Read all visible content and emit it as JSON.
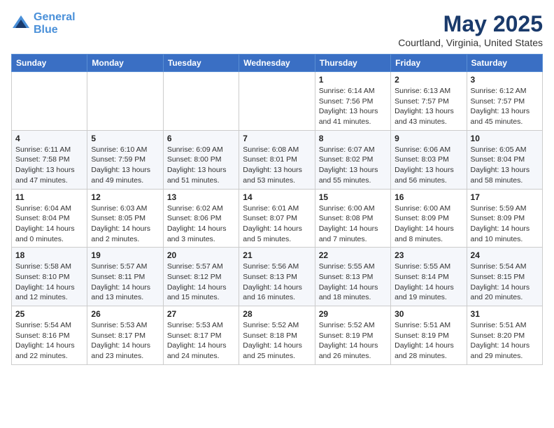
{
  "header": {
    "logo_line1": "General",
    "logo_line2": "Blue",
    "main_title": "May 2025",
    "subtitle": "Courtland, Virginia, United States"
  },
  "days_of_week": [
    "Sunday",
    "Monday",
    "Tuesday",
    "Wednesday",
    "Thursday",
    "Friday",
    "Saturday"
  ],
  "weeks": [
    [
      {
        "day": "",
        "info": ""
      },
      {
        "day": "",
        "info": ""
      },
      {
        "day": "",
        "info": ""
      },
      {
        "day": "",
        "info": ""
      },
      {
        "day": "1",
        "info": "Sunrise: 6:14 AM\nSunset: 7:56 PM\nDaylight: 13 hours\nand 41 minutes."
      },
      {
        "day": "2",
        "info": "Sunrise: 6:13 AM\nSunset: 7:57 PM\nDaylight: 13 hours\nand 43 minutes."
      },
      {
        "day": "3",
        "info": "Sunrise: 6:12 AM\nSunset: 7:57 PM\nDaylight: 13 hours\nand 45 minutes."
      }
    ],
    [
      {
        "day": "4",
        "info": "Sunrise: 6:11 AM\nSunset: 7:58 PM\nDaylight: 13 hours\nand 47 minutes."
      },
      {
        "day": "5",
        "info": "Sunrise: 6:10 AM\nSunset: 7:59 PM\nDaylight: 13 hours\nand 49 minutes."
      },
      {
        "day": "6",
        "info": "Sunrise: 6:09 AM\nSunset: 8:00 PM\nDaylight: 13 hours\nand 51 minutes."
      },
      {
        "day": "7",
        "info": "Sunrise: 6:08 AM\nSunset: 8:01 PM\nDaylight: 13 hours\nand 53 minutes."
      },
      {
        "day": "8",
        "info": "Sunrise: 6:07 AM\nSunset: 8:02 PM\nDaylight: 13 hours\nand 55 minutes."
      },
      {
        "day": "9",
        "info": "Sunrise: 6:06 AM\nSunset: 8:03 PM\nDaylight: 13 hours\nand 56 minutes."
      },
      {
        "day": "10",
        "info": "Sunrise: 6:05 AM\nSunset: 8:04 PM\nDaylight: 13 hours\nand 58 minutes."
      }
    ],
    [
      {
        "day": "11",
        "info": "Sunrise: 6:04 AM\nSunset: 8:04 PM\nDaylight: 14 hours\nand 0 minutes."
      },
      {
        "day": "12",
        "info": "Sunrise: 6:03 AM\nSunset: 8:05 PM\nDaylight: 14 hours\nand 2 minutes."
      },
      {
        "day": "13",
        "info": "Sunrise: 6:02 AM\nSunset: 8:06 PM\nDaylight: 14 hours\nand 3 minutes."
      },
      {
        "day": "14",
        "info": "Sunrise: 6:01 AM\nSunset: 8:07 PM\nDaylight: 14 hours\nand 5 minutes."
      },
      {
        "day": "15",
        "info": "Sunrise: 6:00 AM\nSunset: 8:08 PM\nDaylight: 14 hours\nand 7 minutes."
      },
      {
        "day": "16",
        "info": "Sunrise: 6:00 AM\nSunset: 8:09 PM\nDaylight: 14 hours\nand 8 minutes."
      },
      {
        "day": "17",
        "info": "Sunrise: 5:59 AM\nSunset: 8:09 PM\nDaylight: 14 hours\nand 10 minutes."
      }
    ],
    [
      {
        "day": "18",
        "info": "Sunrise: 5:58 AM\nSunset: 8:10 PM\nDaylight: 14 hours\nand 12 minutes."
      },
      {
        "day": "19",
        "info": "Sunrise: 5:57 AM\nSunset: 8:11 PM\nDaylight: 14 hours\nand 13 minutes."
      },
      {
        "day": "20",
        "info": "Sunrise: 5:57 AM\nSunset: 8:12 PM\nDaylight: 14 hours\nand 15 minutes."
      },
      {
        "day": "21",
        "info": "Sunrise: 5:56 AM\nSunset: 8:13 PM\nDaylight: 14 hours\nand 16 minutes."
      },
      {
        "day": "22",
        "info": "Sunrise: 5:55 AM\nSunset: 8:13 PM\nDaylight: 14 hours\nand 18 minutes."
      },
      {
        "day": "23",
        "info": "Sunrise: 5:55 AM\nSunset: 8:14 PM\nDaylight: 14 hours\nand 19 minutes."
      },
      {
        "day": "24",
        "info": "Sunrise: 5:54 AM\nSunset: 8:15 PM\nDaylight: 14 hours\nand 20 minutes."
      }
    ],
    [
      {
        "day": "25",
        "info": "Sunrise: 5:54 AM\nSunset: 8:16 PM\nDaylight: 14 hours\nand 22 minutes."
      },
      {
        "day": "26",
        "info": "Sunrise: 5:53 AM\nSunset: 8:17 PM\nDaylight: 14 hours\nand 23 minutes."
      },
      {
        "day": "27",
        "info": "Sunrise: 5:53 AM\nSunset: 8:17 PM\nDaylight: 14 hours\nand 24 minutes."
      },
      {
        "day": "28",
        "info": "Sunrise: 5:52 AM\nSunset: 8:18 PM\nDaylight: 14 hours\nand 25 minutes."
      },
      {
        "day": "29",
        "info": "Sunrise: 5:52 AM\nSunset: 8:19 PM\nDaylight: 14 hours\nand 26 minutes."
      },
      {
        "day": "30",
        "info": "Sunrise: 5:51 AM\nSunset: 8:19 PM\nDaylight: 14 hours\nand 28 minutes."
      },
      {
        "day": "31",
        "info": "Sunrise: 5:51 AM\nSunset: 8:20 PM\nDaylight: 14 hours\nand 29 minutes."
      }
    ]
  ]
}
